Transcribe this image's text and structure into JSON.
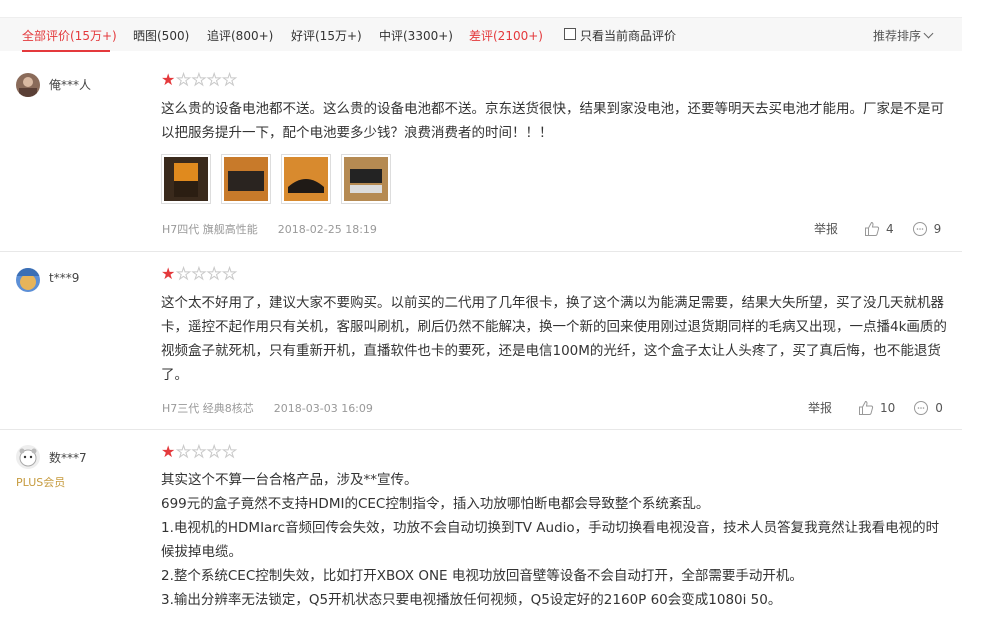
{
  "filters": {
    "all": "全部评价(15万+)",
    "photos": "晒图(500)",
    "followup": "追评(800+)",
    "good": "好评(15万+)",
    "medium": "中评(3300+)",
    "bad": "差评(2100+)",
    "only_current": "只看当前商品评价",
    "sort": "推荐排序"
  },
  "reviews": [
    {
      "username": "俺***人",
      "rating": 1,
      "content": "这么贵的设备电池都不送。这么贵的设备电池都不送。京东送货很快，结果到家没电池，还要等明天去买电池才能用。厂家是不是可以把服务提升一下，配个电池要多少钱？浪费消费者的时间！！！",
      "product": "H7四代 旗舰高性能",
      "date": "2018-02-25 18:19",
      "report": "举报",
      "likes": "4",
      "replies": "9"
    },
    {
      "username": "t***9",
      "rating": 1,
      "content": "这个太不好用了，建议大家不要购买。以前买的二代用了几年很卡，换了这个满以为能满足需要，结果大失所望，买了没几天就机器卡，遥控不起作用只有关机，客服叫刷机，刷后仍然不能解决，换一个新的回来使用刚过退货期同样的毛病又出现，一点播4k画质的视频盒子就死机，只有重新开机，直播软件也卡的要死，还是电信100M的光纤，这个盒子太让人头疼了，买了真后悔，也不能退货了。",
      "product": "H7三代 经典8核芯",
      "date": "2018-03-03 16:09",
      "report": "举报",
      "likes": "10",
      "replies": "0"
    },
    {
      "username": "数***7",
      "badge": "PLUS会员",
      "rating": 1,
      "lines": [
        "其实这个不算一台合格产品，涉及**宣传。",
        "699元的盒子竟然不支持HDMI的CEC控制指令，插入功放哪怕断电都会导致整个系统紊乱。",
        "1.电视机的HDMIarc音频回传会失效，功放不会自动切换到TV Audio，手动切换看电视没音，技术人员答复我竟然让我看电视的时候拔掉电缆。",
        "2.整个系统CEC控制失效，比如打开XBOX ONE 电视功放回音壁等设备不会自动打开，全部需要手动开机。",
        "3.输出分辨率无法锁定，Q5开机状态只要电视播放任何视频，Q5设定好的2160P 60会变成1080i 50。"
      ]
    }
  ],
  "colors": {
    "accent": "#e4393c",
    "plus": "#c69b3f"
  }
}
